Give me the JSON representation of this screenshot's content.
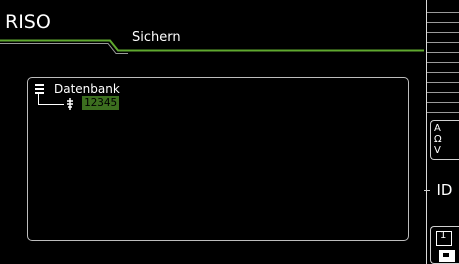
{
  "header": {
    "title": "RISO",
    "subtitle": "Sichern"
  },
  "tree": {
    "root_label": "Datenbank",
    "root_icon": "database-tree-icon",
    "item_icon": "probe-icon",
    "item_value": "12345"
  },
  "sidebar": {
    "unit_button": {
      "lines": [
        "A",
        "Ω",
        "V"
      ]
    },
    "id_label": "ID",
    "save_icon": "save-memory-icon",
    "save_label": "1"
  },
  "colors": {
    "background": "#000000",
    "accent_green": "#5fa82f",
    "selection_green": "#3c6e1f",
    "frame": "#bdbdbd"
  }
}
